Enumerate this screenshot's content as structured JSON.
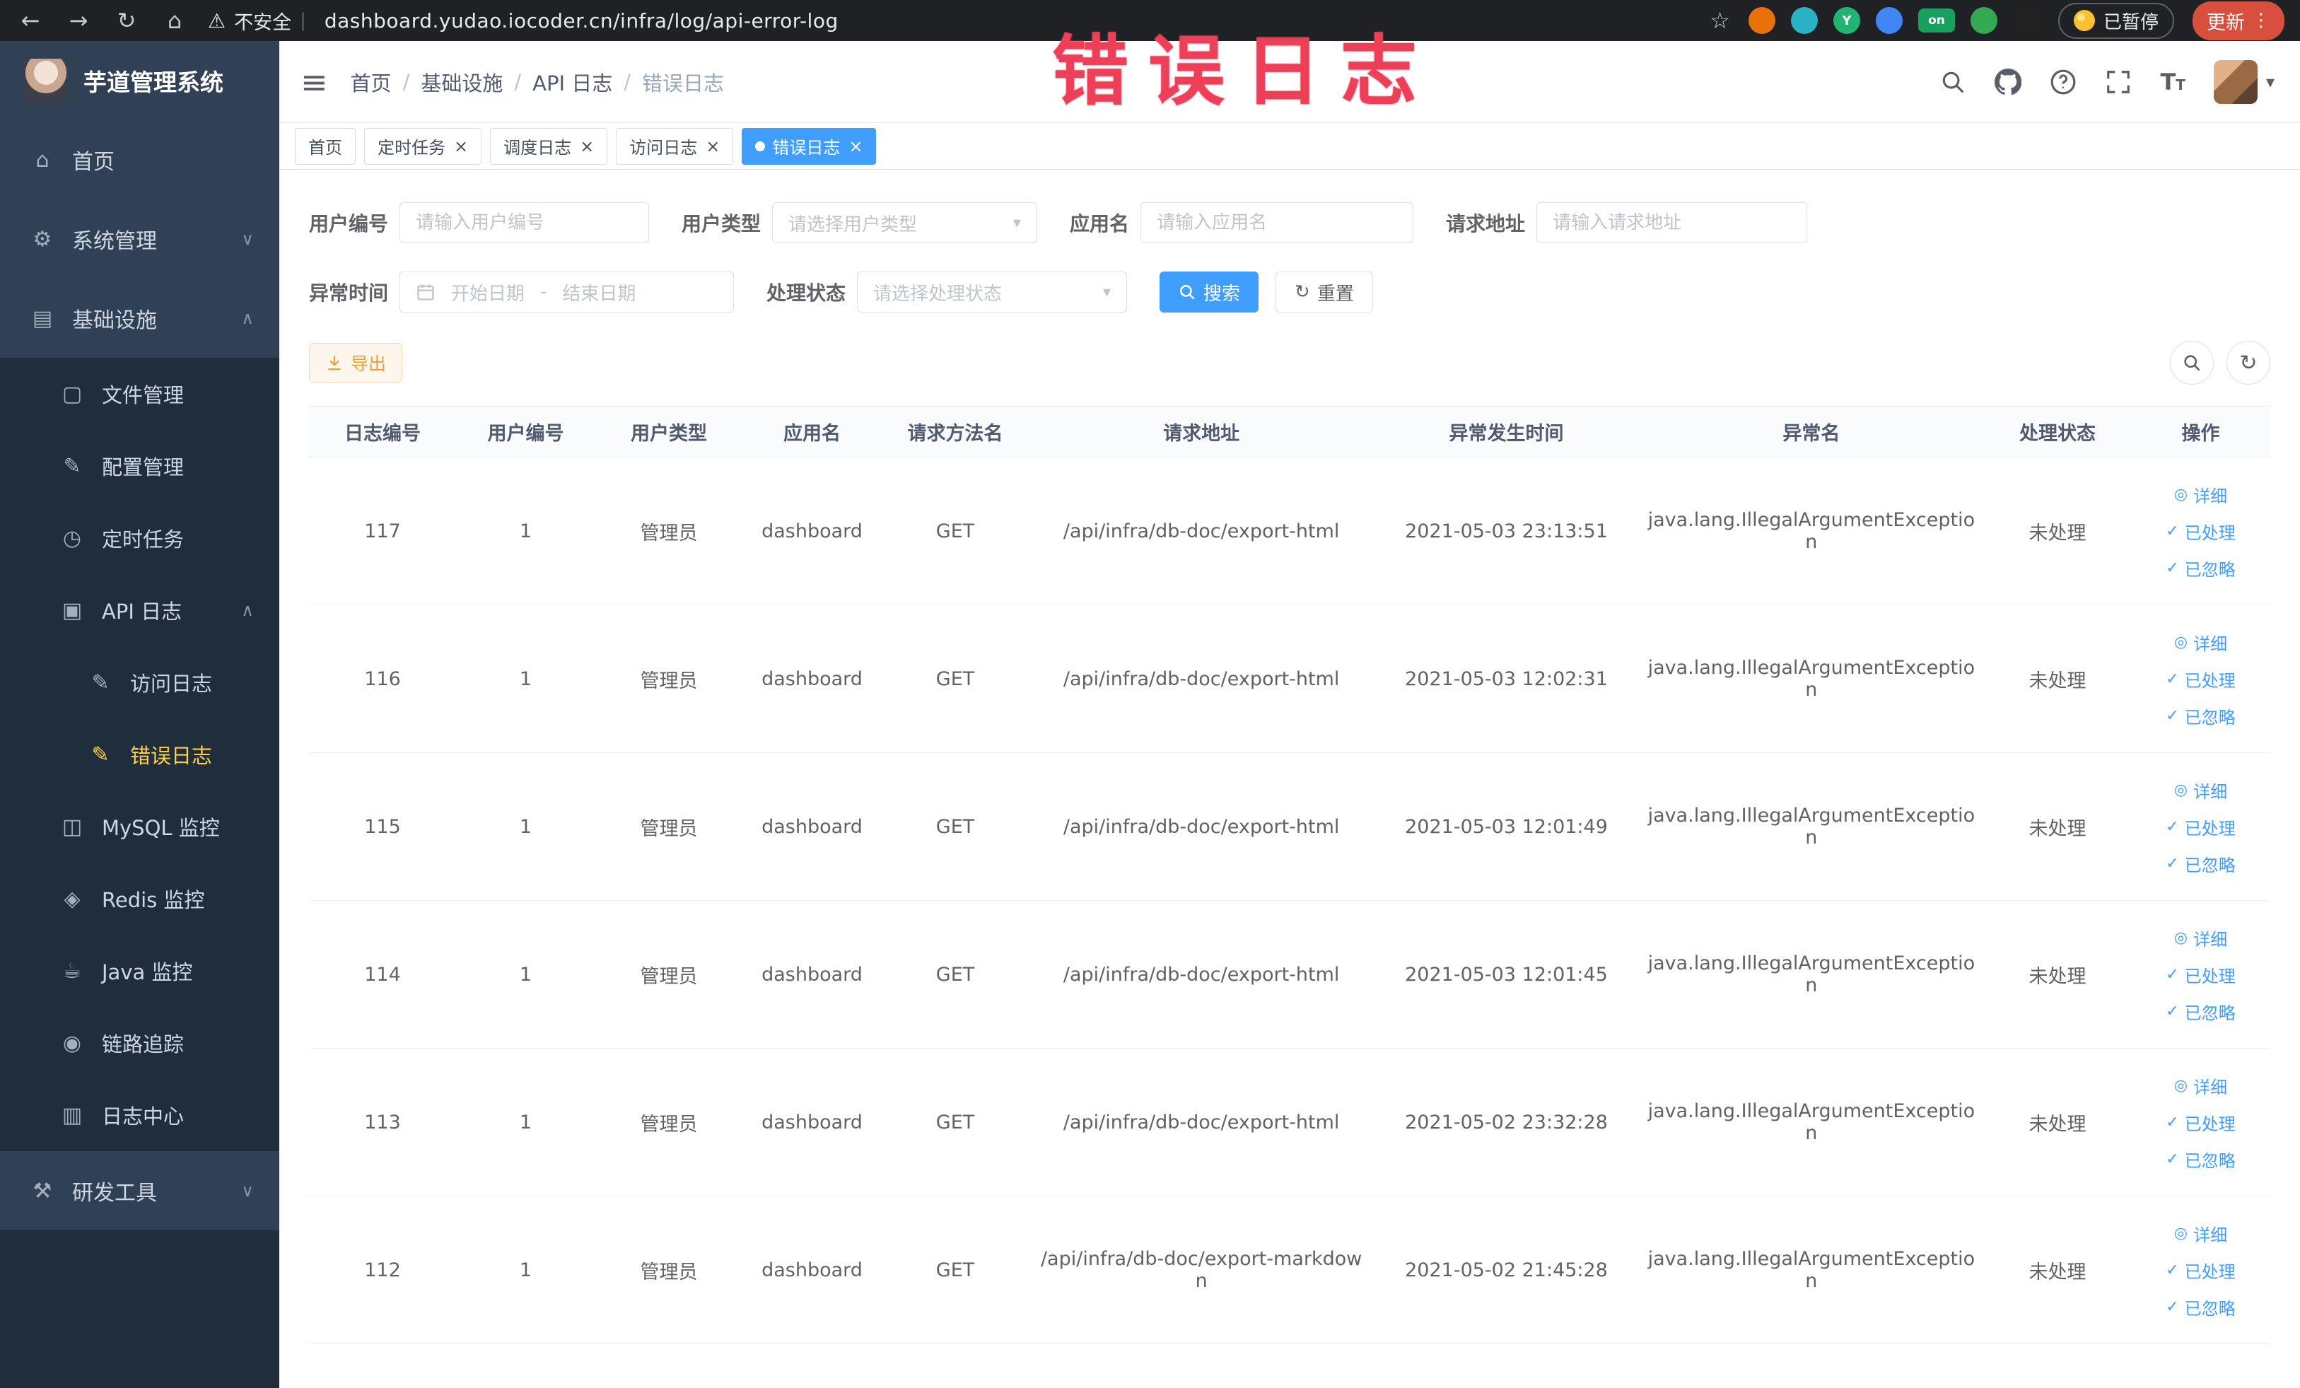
{
  "colors": {
    "accent": "#409eff",
    "sidebar_bg": "#304156",
    "submenu_bg": "#1f2d3d",
    "active_menu_text": "#ffd04b",
    "annotation": "#ee3f58",
    "warning": "#e6a23c"
  },
  "annotation_text": "错误日志",
  "browser": {
    "security_label": "不安全",
    "url": "dashboard.yudao.iocoder.cn/infra/log/api-error-log",
    "paused_label": "已暂停",
    "update_label": "更新",
    "extensions": [
      {
        "id": "orange-circle",
        "color": "#e8710a",
        "glyph": ""
      },
      {
        "id": "teal-drop",
        "color": "#2bb1c4",
        "glyph": ""
      },
      {
        "id": "green-y",
        "color": "#21b573",
        "glyph": "Y"
      },
      {
        "id": "blue-grid",
        "color": "#4285f4",
        "glyph": ""
      },
      {
        "id": "on-badge",
        "color": "#17a05e",
        "glyph": "on"
      },
      {
        "id": "green-leaf",
        "color": "#34a853",
        "glyph": ""
      },
      {
        "id": "dark-paw",
        "color": "#222222",
        "glyph": ""
      }
    ]
  },
  "sidebar": {
    "logo_title": "芋道管理系统",
    "items": [
      {
        "id": "home",
        "label": "首页",
        "icon": "home-icon",
        "glyph": "⌂",
        "level": 1
      },
      {
        "id": "system",
        "label": "系统管理",
        "icon": "gear-icon",
        "glyph": "⚙",
        "level": 1,
        "chevron": "down"
      },
      {
        "id": "infra",
        "label": "基础设施",
        "icon": "infra-icon",
        "glyph": "▤",
        "level": 1,
        "chevron": "up"
      },
      {
        "id": "file",
        "label": "文件管理",
        "icon": "folder-icon",
        "glyph": "▢",
        "level": 2
      },
      {
        "id": "config",
        "label": "配置管理",
        "icon": "edit-icon",
        "glyph": "✎",
        "level": 2
      },
      {
        "id": "job",
        "label": "定时任务",
        "icon": "clock-icon",
        "glyph": "◷",
        "level": 2
      },
      {
        "id": "api-log",
        "label": "API 日志",
        "icon": "log-icon",
        "glyph": "▣",
        "level": 2,
        "chevron": "up"
      },
      {
        "id": "access-log",
        "label": "访问日志",
        "icon": "access-log-icon",
        "glyph": "✎",
        "level": 3
      },
      {
        "id": "error-log",
        "label": "错误日志",
        "icon": "error-log-icon",
        "glyph": "✎",
        "level": 3,
        "active": true
      },
      {
        "id": "mysql",
        "label": "MySQL 监控",
        "icon": "mysql-icon",
        "glyph": "◫",
        "level": 2
      },
      {
        "id": "redis",
        "label": "Redis 监控",
        "icon": "redis-icon",
        "glyph": "◈",
        "level": 2
      },
      {
        "id": "java",
        "label": "Java 监控",
        "icon": "java-icon",
        "glyph": "☕",
        "level": 2
      },
      {
        "id": "trace",
        "label": "链路追踪",
        "icon": "trace-icon",
        "glyph": "◉",
        "level": 2
      },
      {
        "id": "log-center",
        "label": "日志中心",
        "icon": "log-center-icon",
        "glyph": "▥",
        "level": 2
      },
      {
        "id": "dev-tools",
        "label": "研发工具",
        "icon": "tools-icon",
        "glyph": "⚒",
        "level": 1,
        "chevron": "down"
      }
    ]
  },
  "header": {
    "breadcrumb": [
      "首页",
      "基础设施",
      "API 日志",
      "错误日志"
    ]
  },
  "tabs": [
    {
      "id": "home",
      "label": "首页",
      "closable": false,
      "active": false
    },
    {
      "id": "job",
      "label": "定时任务",
      "closable": true,
      "active": false
    },
    {
      "id": "job-log",
      "label": "调度日志",
      "closable": true,
      "active": false
    },
    {
      "id": "access-log",
      "label": "访问日志",
      "closable": true,
      "active": false
    },
    {
      "id": "error-log",
      "label": "错误日志",
      "closable": true,
      "active": true
    }
  ],
  "filters": {
    "user_id": {
      "label": "用户编号",
      "placeholder": "请输入用户编号"
    },
    "user_type": {
      "label": "用户类型",
      "placeholder": "请选择用户类型"
    },
    "app_name": {
      "label": "应用名",
      "placeholder": "请输入应用名"
    },
    "request_url": {
      "label": "请求地址",
      "placeholder": "请输入请求地址"
    },
    "exception_time": {
      "label": "异常时间",
      "start_placeholder": "开始日期",
      "separator": "-",
      "end_placeholder": "结束日期"
    },
    "process_status": {
      "label": "处理状态",
      "placeholder": "请选择处理状态"
    },
    "search_label": "搜索",
    "reset_label": "重置"
  },
  "toolbar": {
    "export_label": "导出"
  },
  "table": {
    "columns": [
      "日志编号",
      "用户编号",
      "用户类型",
      "应用名",
      "请求方法名",
      "请求地址",
      "异常发生时间",
      "异常名",
      "处理状态",
      "操作"
    ],
    "col_widths": [
      "7.5%",
      "7.1%",
      "7.5%",
      "7.1%",
      "7.5%",
      "17.6%",
      "13.5%",
      "17.6%",
      "7.5%",
      "7.1%"
    ],
    "row_actions": [
      {
        "name": "detail",
        "label": "详细",
        "icon": "eye-icon",
        "glyph": "◎"
      },
      {
        "name": "processed",
        "label": "已处理",
        "icon": "check-icon",
        "glyph": "✓"
      },
      {
        "name": "ignored",
        "label": "已忽略",
        "icon": "check-icon",
        "glyph": "✓"
      }
    ],
    "rows": [
      [
        "117",
        "1",
        "管理员",
        "dashboard",
        "GET",
        "/api/infra/db-doc/export-html",
        "2021-05-03 23:13:51",
        "java.lang.IllegalArgumentException",
        "未处理"
      ],
      [
        "116",
        "1",
        "管理员",
        "dashboard",
        "GET",
        "/api/infra/db-doc/export-html",
        "2021-05-03 12:02:31",
        "java.lang.IllegalArgumentException",
        "未处理"
      ],
      [
        "115",
        "1",
        "管理员",
        "dashboard",
        "GET",
        "/api/infra/db-doc/export-html",
        "2021-05-03 12:01:49",
        "java.lang.IllegalArgumentException",
        "未处理"
      ],
      [
        "114",
        "1",
        "管理员",
        "dashboard",
        "GET",
        "/api/infra/db-doc/export-html",
        "2021-05-03 12:01:45",
        "java.lang.IllegalArgumentException",
        "未处理"
      ],
      [
        "113",
        "1",
        "管理员",
        "dashboard",
        "GET",
        "/api/infra/db-doc/export-html",
        "2021-05-02 23:32:28",
        "java.lang.IllegalArgumentException",
        "未处理"
      ],
      [
        "112",
        "1",
        "管理员",
        "dashboard",
        "GET",
        "/api/infra/db-doc/export-markdown",
        "2021-05-02 21:45:28",
        "java.lang.IllegalArgumentException",
        "未处理"
      ]
    ]
  }
}
